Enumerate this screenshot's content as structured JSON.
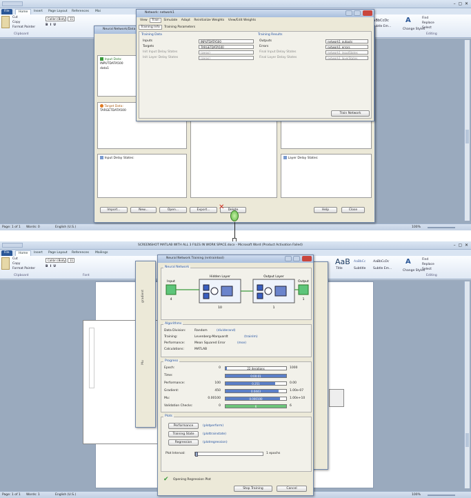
{
  "top": {
    "word": {
      "tabs": [
        "File",
        "Home",
        "Insert",
        "Page Layout",
        "References",
        "Mai"
      ],
      "clipboard": {
        "cut": "Cut",
        "copy": "Copy",
        "format_painter": "Format Painter",
        "group": "Clipboard"
      },
      "font": {
        "name": "Calibri (Body)",
        "size": "11"
      },
      "styles": {
        "style_sample": "AaBbCcDc",
        "style_name": "Subtle Em...",
        "change_styles": "Change Styles"
      },
      "editing": {
        "find": "Find",
        "replace": "Replace",
        "select": "Select",
        "group": "Editing"
      },
      "status": {
        "page": "Page: 1 of 1",
        "words": "Words: 0",
        "lang": "English (U.S.)",
        "zoom": "100%"
      }
    },
    "nntool": {
      "title": "Neural Network/Data Manager (nntool)",
      "input_data_label": "Input Data:",
      "input_data_items": [
        "INPUTDATA500",
        "data1"
      ],
      "target_data_label": "Target Data:",
      "target_data_items": [
        "TARGETDATA500"
      ],
      "input_delay_label": "Input Delay States:",
      "layer_delay_label": "Layer Delay States:",
      "buttons": {
        "import": "Import...",
        "new": "New...",
        "open": "Open...",
        "export": "Export...",
        "delete": "Delete",
        "help": "Help",
        "close": "Close"
      }
    },
    "network": {
      "title": "Network: network1",
      "tabs": [
        "View",
        "Train",
        "Simulate",
        "Adapt",
        "Reinitialize Weights",
        "View/Edit Weights"
      ],
      "subtabs": [
        "Training Info",
        "Training Parameters"
      ],
      "training_data_title": "Training Data",
      "training_results_title": "Training Results",
      "inputs_label": "Inputs",
      "inputs_value": "INPUTDATA500",
      "targets_label": "Targets",
      "targets_value": "TARGETDATA500",
      "init_input_label": "Init Input Delay States",
      "init_input_value": "(zeros)",
      "init_layer_label": "Init Layer Delay States",
      "init_layer_value": "(zeros)",
      "outputs_label": "Outputs",
      "outputs_value": "network1_outputs",
      "errors_label": "Errors",
      "errors_value": "network1_errors",
      "final_input_label": "Final Input Delay States",
      "final_input_value": "network1_inputStates",
      "final_layer_label": "Final Layer Delay States",
      "final_layer_value": "network1_layerStates",
      "train_button": "Train Network"
    }
  },
  "bottom": {
    "word": {
      "title": "SCREENSHOT MATLAB WITH ALL 3 FILES IN WORK SPACE.docx - Microsoft Word (Product Activation Failed)",
      "tabs": [
        "File",
        "Home",
        "Insert",
        "Page Layout",
        "References",
        "Mailings"
      ],
      "clipboard": {
        "cut": "Cut",
        "copy": "Copy",
        "format_painter": "Format Painter",
        "group": "Clipboard"
      },
      "font": {
        "name": "Calibri (Body)",
        "size": "11",
        "group": "Font"
      },
      "styles": {
        "sample_big": "AaB",
        "sample1": "AaBbCc",
        "sample2": "AaBbCcDc",
        "name1": "Title",
        "name2": "Subtitle",
        "name3": "Subtle Em...",
        "change_styles": "Change Styles"
      },
      "editing": {
        "find": "Find",
        "replace": "Replace",
        "select": "Select",
        "group": "Editing"
      },
      "status": {
        "page": "Page: 1 of 1",
        "words": "Words: 1",
        "lang": "English (U.S.)",
        "zoom": "100%"
      }
    },
    "training": {
      "title": "Neural Network Training (nntraintool)",
      "neural_network": "Neural Network",
      "hidden_layer": "Hidden Layer",
      "output_layer": "Output Layer",
      "input_label": "Input",
      "output_label": "Output",
      "input_size": "4",
      "hidden_size": "10",
      "output_size": "1",
      "output_out_size": "1",
      "algorithms": "Algorithms",
      "data_division_label": "Data Division:",
      "data_division": "Random",
      "data_division_fn": "(dividerand)",
      "training_label": "Training:",
      "training_alg": "Levenberg-Marquardt",
      "training_fn": "(trainlm)",
      "performance_label": "Performance:",
      "performance_alg": "Mean Squared Error",
      "performance_fn": "(mse)",
      "calculations_label": "Calculations:",
      "calculations": "MATLAB",
      "progress": "Progress",
      "rows": [
        {
          "name": "Epoch:",
          "start": "0",
          "current": "22 iterations",
          "end": "1000",
          "frac": 0.022,
          "color": "#5a7fc8"
        },
        {
          "name": "Time:",
          "start": "",
          "current": "0:00:01",
          "end": "",
          "frac": 1.0,
          "color": "#5a7fc8"
        },
        {
          "name": "Performance:",
          "start": "100",
          "current": "0.251",
          "end": "0.00",
          "frac": 0.82,
          "color": "#5a7fc8"
        },
        {
          "name": "Gradient:",
          "start": "450",
          "current": "0.0443",
          "end": "1.00e-07",
          "frac": 0.88,
          "color": "#5a7fc8"
        },
        {
          "name": "Mu:",
          "start": "0.00100",
          "current": "0.000100",
          "end": "1.00e+10",
          "frac": 0.9,
          "color": "#5a7fc8"
        },
        {
          "name": "Validation Checks:",
          "start": "0",
          "current": "6",
          "end": "6",
          "frac": 1.0,
          "color": "#6cc47a"
        }
      ],
      "plots": "Plots",
      "plot_buttons": [
        {
          "label": "Performance",
          "fn": "(plotperform)"
        },
        {
          "label": "Training State",
          "fn": "(plottrainstate)"
        },
        {
          "label": "Regression",
          "fn": "(plotregression)"
        }
      ],
      "plot_interval_label": "Plot Interval:",
      "plot_interval_value": "1 epochs",
      "status": "Opening Regression Plot",
      "stop_button": "Stop Training",
      "cancel_button": "Cancel"
    },
    "side_labels": [
      "gradient",
      "Mu"
    ]
  }
}
